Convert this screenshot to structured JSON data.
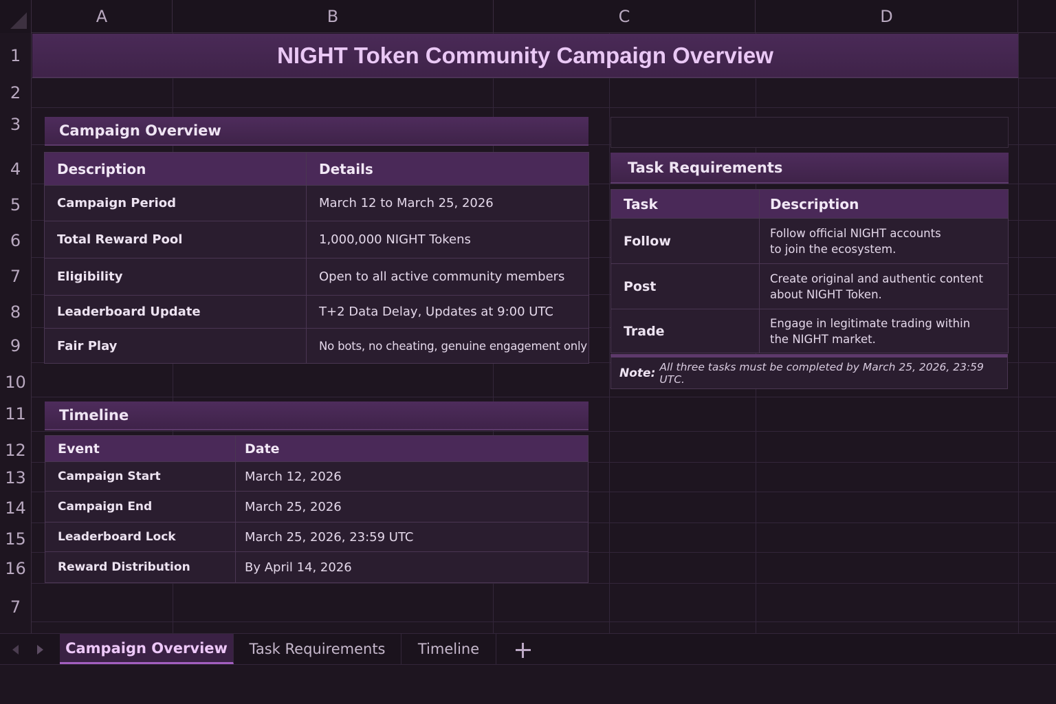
{
  "columns": [
    "A",
    "B",
    "C",
    "D"
  ],
  "rows": [
    "1",
    "2",
    "3",
    "4",
    "5",
    "6",
    "7",
    "8",
    "9",
    "10",
    "11",
    "12",
    "13",
    "14",
    "15",
    "16",
    "7"
  ],
  "title": "NIGHT Token Community Campaign Overview",
  "overview": {
    "header": "Campaign Overview",
    "col_headers": [
      "Description",
      "Details"
    ],
    "rows": [
      {
        "label": "Campaign Period",
        "value": "March 12 to March 25, 2026"
      },
      {
        "label": "Total Reward Pool",
        "value": "1,000,000 NIGHT Tokens"
      },
      {
        "label": "Eligibility",
        "value": "Open to all active community members"
      },
      {
        "label": "Leaderboard Update",
        "value": "T+2 Data Delay, Updates at 9:00 UTC"
      },
      {
        "label": "Fair Play",
        "value": "No bots, no cheating, genuine engagement only"
      }
    ]
  },
  "tasks": {
    "header": "Task Requirements",
    "col_headers": [
      "Task",
      "Description"
    ],
    "rows": [
      {
        "task": "Follow",
        "line1": "Follow official NIGHT accounts",
        "line2": "to join the ecosystem."
      },
      {
        "task": "Post",
        "line1": "Create original and authentic content",
        "line2": "about NIGHT Token."
      },
      {
        "task": "Trade",
        "line1": "Engage in legitimate trading within",
        "line2": "the NIGHT market."
      }
    ],
    "note_label": "Note:",
    "note_text": "All three tasks must be completed by March 25, 2026, 23:59 UTC."
  },
  "timeline": {
    "header": "Timeline",
    "col_headers": [
      "Event",
      "Date"
    ],
    "rows": [
      {
        "event": "Campaign Start",
        "date": "March 12, 2026"
      },
      {
        "event": "Campaign End",
        "date": "March 25, 2026"
      },
      {
        "event": "Leaderboard Lock",
        "date": "March 25, 2026, 23:59 UTC"
      },
      {
        "event": "Reward Distribution",
        "date": "By April 14, 2026"
      }
    ]
  },
  "sheet_tabs": [
    "Campaign Overview",
    "Task Requirements",
    "Timeline"
  ],
  "active_tab": "Campaign Overview",
  "colors": {
    "accent": "#a35fc0",
    "header_bg": "#4a2958",
    "background": "#1e1520"
  }
}
